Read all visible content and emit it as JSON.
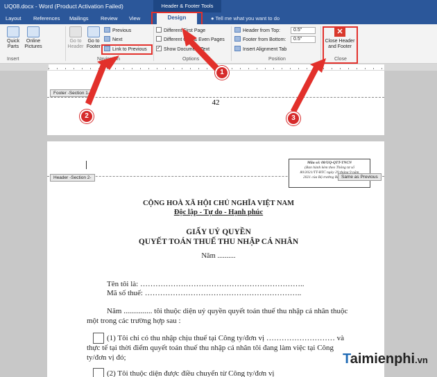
{
  "window": {
    "title": "UQ08.docx - Word (Product Activation Failed)",
    "context_tools": "Header & Footer Tools"
  },
  "tabs": [
    "Layout",
    "References",
    "Mailings",
    "Review",
    "View",
    "Design"
  ],
  "active_tab": "Design",
  "tell_me": "Tell me what you want to do",
  "ribbon": {
    "insert_group": {
      "quick_parts": "Quick Parts",
      "online_pictures": "Online Pictures",
      "label": "Insert"
    },
    "navigation_group": {
      "go_to_header": "Go to Header",
      "go_to_footer": "Go to Footer",
      "previous": "Previous",
      "next": "Next",
      "link_to_previous": "Link to Previous",
      "label": "Navigation"
    },
    "options_group": {
      "different_first_page": "Different First Page",
      "different_odd_even": "Different Odd & Even Pages",
      "show_document_text": "Show Document Text",
      "label": "Options"
    },
    "position_group": {
      "header_from_top": "Header from Top:",
      "header_from_top_value": "0.5\"",
      "footer_from_bottom": "Footer from Bottom:",
      "footer_from_bottom_value": "0.5\"",
      "insert_alignment_tab": "Insert Alignment Tab",
      "label": "Position"
    },
    "close_group": {
      "close_button": "Close Header and Footer",
      "label": "Close"
    }
  },
  "page1": {
    "footer_tag": "Footer -Section 1-",
    "page_number": "42"
  },
  "page2": {
    "header_tag": "Header -Section 2-",
    "same_as_previous": "Same as Previous",
    "form_box": {
      "code": "Mẫu số: 08/UQ-QTT-TNCN",
      "line2": "(Ban hành kèm theo Thông tư số",
      "line3": "80/2021/TT-BTC ngày 29 tháng 9 năm",
      "line4": "2021 của Bộ trưởng Bộ Tài chính)"
    },
    "nation": "CỘNG HOÀ XÃ HỘI CHỦ NGHĨA VIỆT NAM",
    "motto": "Độc lập - Tự do - Hạnh phúc",
    "title1": "GIẤY UỶ QUYỀN",
    "title2": "QUYẾT TOÁN THUẾ THU NHẬP CÁ NHÂN",
    "year": "Năm ..........",
    "name_line": "Tên tôi là: ………………………………………………………..",
    "tax_line": "Mã số thuế: ……………………………………………………..",
    "para_line1": "Năm ............... tôi thuộc diện uỷ quyền quyết toán thuế thu nhập cá nhân thuộc",
    "para_line2": "một trong các trường hợp sau :",
    "opt1_line1": "(1) Tôi chỉ có thu nhập chịu thuế tại Công ty/đơn vị ……………………… và",
    "opt1_line2": "thực tế tại thời điểm quyết toán thuế thu nhập cá nhân tôi đang làm việc tại Công",
    "opt1_line3": "ty/đơn vị đó;",
    "opt2_line1": "(2) Tôi thuộc diện được điều chuyển từ Công ty/đơn vị"
  },
  "markers": [
    "1",
    "2",
    "3"
  ],
  "watermark": {
    "brand": "aimienphi",
    "brand_first": "T",
    "domain": ".vn"
  },
  "colors": {
    "word_blue": "#2b579a",
    "highlight_red": "#e2302b",
    "marker_red": "#d62b2b"
  }
}
